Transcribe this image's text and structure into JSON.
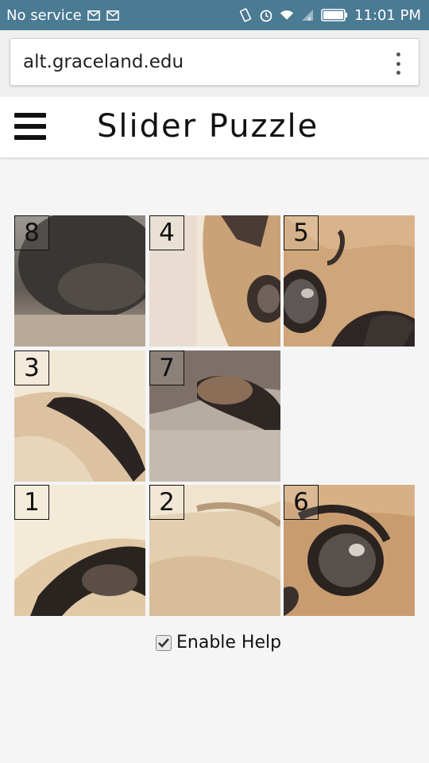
{
  "status_bar": {
    "carrier": "No service",
    "time": "11:01 PM",
    "icons": [
      "mail-icon",
      "mail-icon",
      "vibrate-icon",
      "alarm-icon",
      "wifi-icon",
      "signal-icon",
      "battery-icon"
    ]
  },
  "browser": {
    "url": "alt.graceland.edu",
    "menu_icon": "more-vert-icon"
  },
  "header": {
    "title": "Slider Puzzle",
    "menu_icon": "hamburger-icon"
  },
  "puzzle": {
    "grid": [
      [
        "8",
        "4",
        "5"
      ],
      [
        "3",
        "7",
        ""
      ],
      [
        "1",
        "2",
        "6"
      ]
    ]
  },
  "help": {
    "label": "Enable Help",
    "checked": true
  },
  "colors": {
    "status_bar": "#4b7a93",
    "background": "#f5f5f5"
  }
}
